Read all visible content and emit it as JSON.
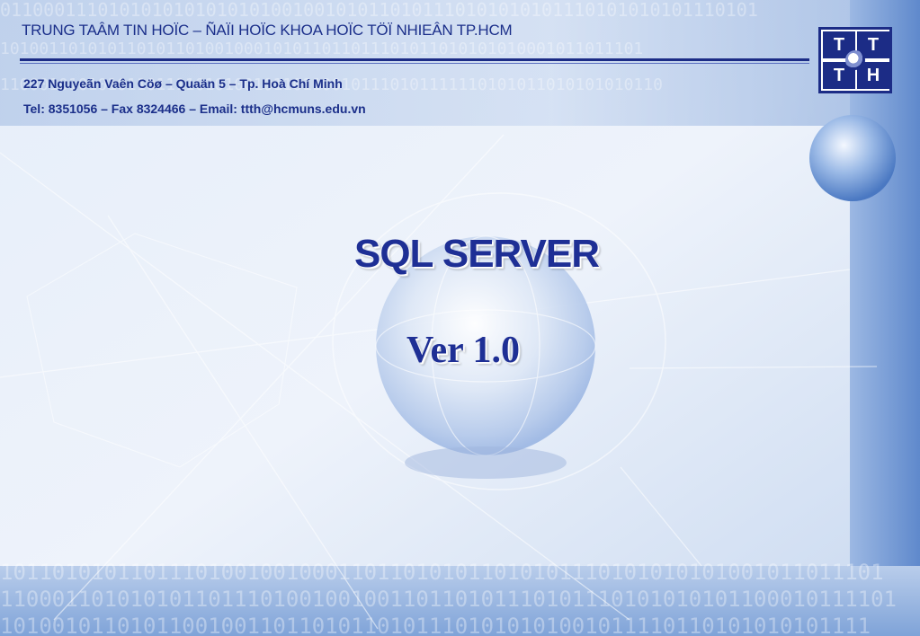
{
  "header": {
    "title": "TRUNG TAÂM TIN HOÏC – ÑAÏI HOÏC KHOA HOÏC TÖÏ NHIEÂN TP.HCM",
    "address": "227 Nguyeãn Vaên Cöø – Quaän 5 – Tp. Hoà Chí Minh",
    "contact": "Tel: 8351056 – Fax 8324466 –  Email: ttth@hcmuns.edu.vn"
  },
  "logo": {
    "letters": [
      "T",
      "T",
      "T",
      "H"
    ]
  },
  "slide": {
    "title": "SQL SERVER",
    "subtitle": "Ver 1.0"
  },
  "background": {
    "binary_rows": [
      "0110001110101010101010101001001010110101110101010101110101010101110101",
      "101001101010110101101001000101011011011101011010101010001011011101",
      "11000101010101101111010100101101100101110101111110101011010101010110",
      "10110101011011101001001000110110101011010101110101010101001011011101",
      "110001101010101101110100100100110110101110101110101010101100010111101",
      "1010010110101100100110110101101011101010101001011110110101010101111"
    ],
    "colors": {
      "primary": "#1c2c86",
      "title": "#1e2f95",
      "sky": "#dfe9f7"
    }
  }
}
